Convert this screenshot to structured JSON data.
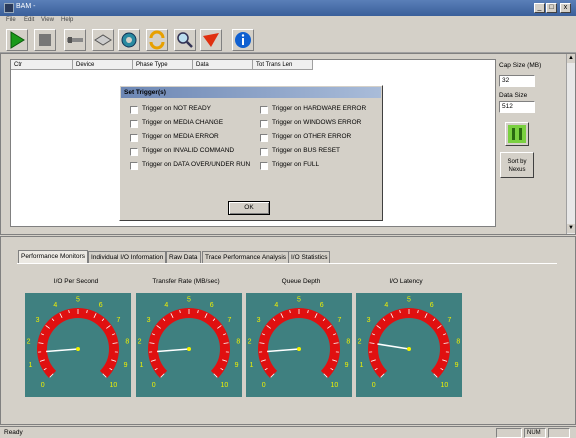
{
  "window": {
    "title": "BAM -"
  },
  "menu": [
    "File",
    "Edit",
    "View",
    "Help"
  ],
  "toolbar": {
    "icons": [
      "play-icon",
      "stop-icon",
      "connect-icon",
      "device-icon",
      "settings-icon",
      "refresh-icon",
      "search-icon",
      "trigger-icon",
      "info-icon"
    ]
  },
  "table": {
    "columns": [
      "Ctr",
      "Device",
      "Phase Type",
      "Data",
      "Tot Trans Len"
    ]
  },
  "side": {
    "cap_size_label": "Cap Size (MB)",
    "cap_size_value": "32",
    "data_size_label": "Data Size",
    "data_size_value": "512",
    "sort_label_1": "Sort by",
    "sort_label_2": "Nexus"
  },
  "dialog": {
    "title": "Set Trigger(s)",
    "left": [
      "Trigger on NOT READY",
      "Trigger on MEDIA CHANGE",
      "Trigger on MEDIA ERROR",
      "Trigger on INVALID COMMAND",
      "Trigger on DATA OVER/UNDER RUN"
    ],
    "right": [
      "Trigger on HARDWARE ERROR",
      "Trigger on WINDOWS ERROR",
      "Trigger on OTHER ERROR",
      "Trigger on BUS RESET",
      "Trigger on FULL"
    ],
    "ok": "OK"
  },
  "tabs": [
    "Performance Monitors",
    "Individual I/O Information",
    "Raw Data",
    "Trace Performance Analysis",
    "I/O Statistics"
  ],
  "gauges": [
    {
      "title": "I/O Per Second",
      "value": 1.5
    },
    {
      "title": "Transfer Rate (MB/sec)",
      "value": 1.5
    },
    {
      "title": "Queue Depth",
      "value": 1.5
    },
    {
      "title": "I/O Latency",
      "value": 2
    }
  ],
  "gauge_scale": [
    "0",
    "1",
    "2",
    "3",
    "4",
    "5",
    "6",
    "7",
    "8",
    "9",
    "10"
  ],
  "status": {
    "left": "Ready",
    "num": "NUM"
  },
  "colors": {
    "gauge_bg": "#3f8080",
    "gauge_arc": "#e01010",
    "needle": "#ffffff",
    "tick_label": "#f0f000"
  }
}
